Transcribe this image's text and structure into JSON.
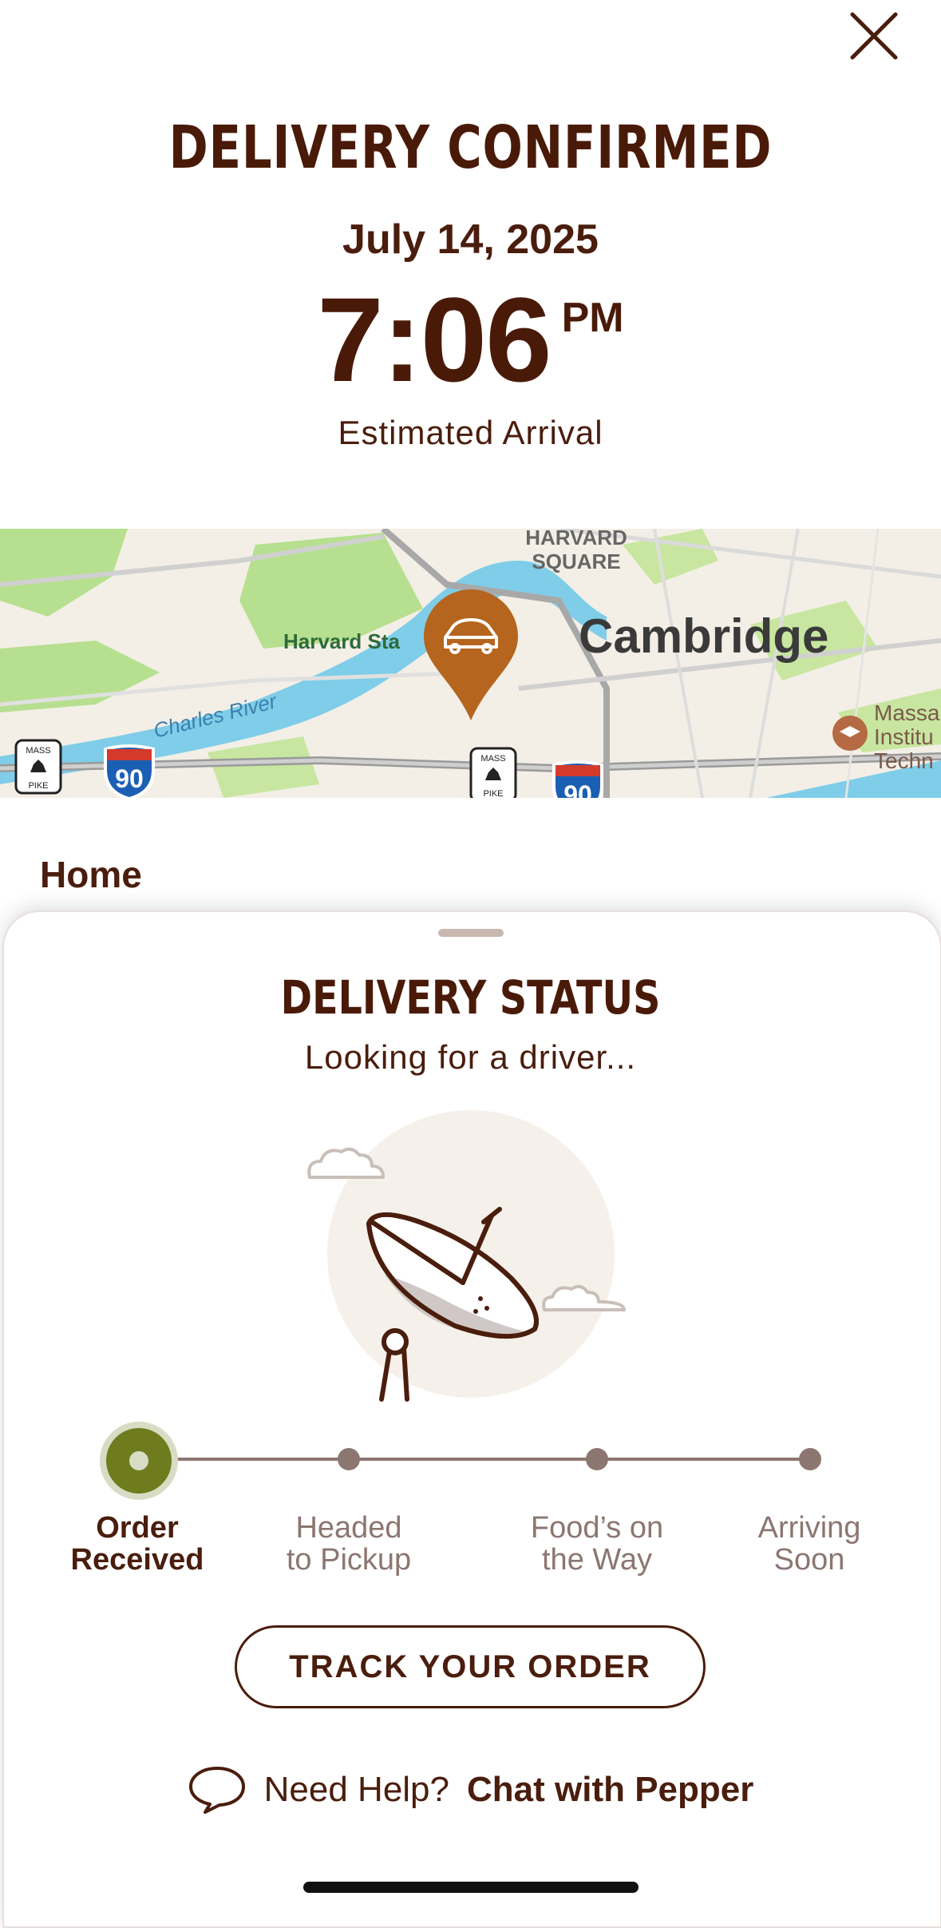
{
  "header": {
    "close_icon": "close-icon",
    "title": "DELIVERY CONFIRMED",
    "date": "July 14, 2025",
    "time": "7:06",
    "ampm": "PM",
    "estimate_label": "Estimated Arrival"
  },
  "map": {
    "labels": {
      "harvard_square_1": "HARVARD",
      "harvard_square_2": "SQUARE",
      "harvard_station": "Harvard Sta",
      "cambridge": "Cambridge",
      "charles_river": "Charles River",
      "mit_1": "Massa",
      "mit_2": "Institu",
      "mit_3": "Techn",
      "shield_90": "90",
      "mass_pike_1": "MASS",
      "mass_pike_2": "PIKE"
    },
    "marker_icon": "car-icon",
    "colors": {
      "marker": "#b5651d",
      "water": "#7fcde8",
      "park": "#b6e08f"
    }
  },
  "location_label": "Home",
  "status": {
    "title": "DELIVERY STATUS",
    "subtitle": "Looking for a driver...",
    "steps": [
      {
        "line1": "Order",
        "line2": "Received",
        "active": true
      },
      {
        "line1": "Headed",
        "line2": "to Pickup",
        "active": false
      },
      {
        "line1": "Food’s on",
        "line2": "the Way",
        "active": false
      },
      {
        "line1": "Arriving",
        "line2": "Soon",
        "active": false
      }
    ],
    "active_color": "#6e7c1e",
    "track_button": "TRACK YOUR ORDER",
    "help_prefix": "Need Help?",
    "help_link": "Chat with Pepper",
    "help_icon": "chat-bubble-icon"
  }
}
